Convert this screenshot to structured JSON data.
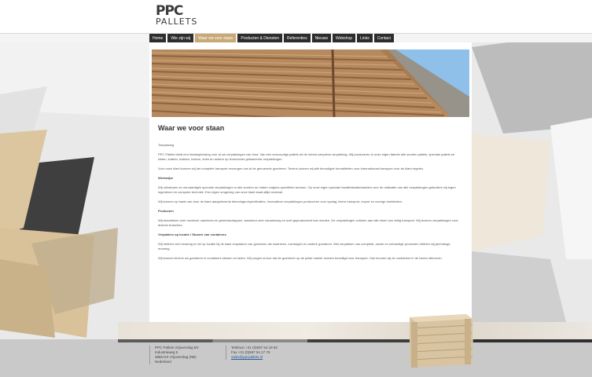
{
  "logo": {
    "top": "PPC",
    "bottom": "PALLETS"
  },
  "nav": {
    "items": [
      {
        "label": "Home"
      },
      {
        "label": "Wie zijn wij"
      },
      {
        "label": "Waar we voor staan"
      },
      {
        "label": "Producten & Diensten"
      },
      {
        "label": "Referenties"
      },
      {
        "label": "Nieuws"
      },
      {
        "label": "Webshop"
      },
      {
        "label": "Links"
      },
      {
        "label": "Contact"
      }
    ]
  },
  "article": {
    "title": "Waar we voor staan",
    "paragraphs": [
      "Toepassing",
      "PPC Pallets biedt een totaaloplossing voor al uw verpakkingen van hout. Van een eenvoudige pallets tot de meest complexe verpakking. Wij produceren in onze eigen fabriek alle soorten pallets, speciale pallets en kisten, kratten, bakken, kokers, duim en andere op leverancier gebaseerde verpakkingen.",
      "Voor onze klant kunnen wij het complete transport verzorgen van al de genoemde goederen. Tevens kunnen wij alle benodigde formaliteiten voor internationaal transport voor de klant regelen.",
      "Werkwijze",
      "Wij ontwerpen en vervaardigen speciale verpakkingen in alle soorten en maten volgens specifieke wensen. Op onze eigen speciale kwaliteitsstandaarden voor de realisatie van alle verpakkingen gebruiken wij eigen ingenieurs en computer techniek. Een eigen omgeving van onze klant staat altijd centraal.",
      "Wij kunnen op basis van door de klant aangeleverde tekeningen/specificaties, innovatieve verpakkingen produceren voor opslag, intern transport, export en overige doeleinden.",
      "Producten",
      "Wij beschikken over moderne machines en gereedschappen, waardoor zeer nauwkeurig en snel geproduceerd kan worden. De verpakkingen voldoen aan alle eisen van veilig transport. Wij leveren verpakkingen voor diverse branches.",
      "Verpakken op locatie / Stuwen van containers",
      "Wij hebben veel ervaring in het op locatie bij de klant verpakken van goederen als machines, voertuigen en andere goederen. Met verpakken van complete, zware en onhandige producten hebben wij jarenlange ervaring.",
      "Wij kunnen tevens uw goederen in containers stuwen en laden. Wij zorgen ervoor dat de goederen op de juiste manier worden beveiligd voor transport. Ook kunnen wij de containers in de haven afleveren."
    ]
  },
  "footer": {
    "col1": [
      "PPC Pallets Vrijoverslag BV",
      "Industrieweg 5",
      "3866 DX Vrijoverslag (NB)",
      "Nederland"
    ],
    "col2": [
      "Telefoon +31 (0)597 54 19 82",
      "Fax +31 (0)597 54 17 76"
    ],
    "email": "sales@ppcpallets.nl"
  }
}
